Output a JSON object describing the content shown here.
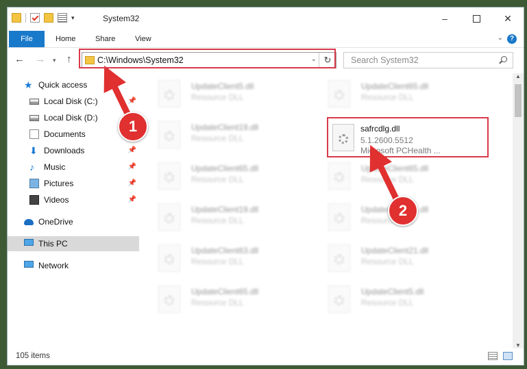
{
  "window": {
    "title": "System32",
    "controls": {
      "minimize": "–",
      "close": "✕"
    }
  },
  "ribbon": {
    "tabs": [
      {
        "label": "File"
      },
      {
        "label": "Home"
      },
      {
        "label": "Share"
      },
      {
        "label": "View"
      }
    ],
    "help": "?"
  },
  "navbar": {
    "path": "C:\\Windows\\System32",
    "search_placeholder": "Search System32"
  },
  "sidebar": {
    "items": [
      {
        "label": "Quick access",
        "icon": "star-icon"
      },
      {
        "label": "Local Disk (C:)",
        "icon": "drive-icon",
        "pinned": true
      },
      {
        "label": "Local Disk (D:)",
        "icon": "drive-icon"
      },
      {
        "label": "Documents",
        "icon": "documents-icon",
        "pinned": true
      },
      {
        "label": "Downloads",
        "icon": "download-icon",
        "pinned": true
      },
      {
        "label": "Music",
        "icon": "music-icon",
        "pinned": true
      },
      {
        "label": "Pictures",
        "icon": "pictures-icon",
        "pinned": true
      },
      {
        "label": "Videos",
        "icon": "videos-icon",
        "pinned": true
      },
      {
        "label": "OneDrive",
        "icon": "onedrive-icon"
      },
      {
        "label": "This PC",
        "icon": "computer-icon",
        "selected": true
      },
      {
        "label": "Network",
        "icon": "network-icon"
      }
    ]
  },
  "files": [
    {
      "name": "UpdateClient5.dll",
      "type": "Resource DLL"
    },
    {
      "name": "UpdateClient65.dll",
      "type": "Resource DLL"
    },
    {
      "name": "UpdateClient19.dll",
      "type": "Resource DLL"
    },
    {
      "name": "safrcdlg.dll",
      "version": "5.1.2600.5512",
      "company": "Microsoft PCHealth ..."
    },
    {
      "name": "UpdateClient65.dll",
      "type": "Resource DLL"
    },
    {
      "name": "UpdateClient65.dll",
      "type": "Resource DLL"
    },
    {
      "name": "UpdateClient19.dll",
      "type": "Resource DLL"
    },
    {
      "name": "UpdateClient21.dll",
      "type": "Resource DLL"
    },
    {
      "name": "UpdateClient63.dll",
      "type": "Resource DLL"
    },
    {
      "name": "UpdateClient21.dll",
      "type": "Resource DLL"
    },
    {
      "name": "UpdateClient65.dll",
      "type": "Resource DLL"
    },
    {
      "name": "UpdateClient5.dll",
      "type": "Resource DLL"
    }
  ],
  "status": {
    "count": "105 items"
  },
  "annotations": {
    "step1": "1",
    "step2": "2",
    "color": "#e0302f"
  }
}
